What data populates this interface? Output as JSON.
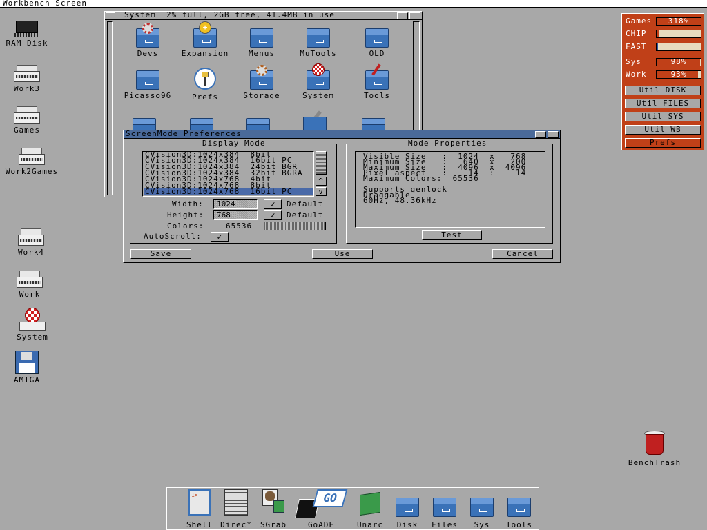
{
  "screen_title": "Workbench Screen",
  "desktop_icons": [
    {
      "label": "RAM Disk",
      "icon": "ram-chip-icon"
    },
    {
      "label": "Work3",
      "icon": "hard-drive-icon"
    },
    {
      "label": "Games",
      "icon": "hard-drive-icon"
    },
    {
      "label": "Work2Games",
      "icon": "hard-drive-icon"
    },
    {
      "label": "Work4",
      "icon": "hard-drive-icon"
    },
    {
      "label": "Work",
      "icon": "hard-drive-icon"
    },
    {
      "label": "System",
      "icon": "boing-ball-drive-icon"
    },
    {
      "label": "AMIGA",
      "icon": "floppy-disk-icon"
    },
    {
      "label": "BenchTrash",
      "icon": "trashcan-icon"
    }
  ],
  "system_window": {
    "title": "System  2% full, 2GB free, 41.4MB in use",
    "icons": [
      {
        "label": "Devs",
        "icon": "gear-drawer-icon"
      },
      {
        "label": "Expansion",
        "icon": "plus-drawer-icon"
      },
      {
        "label": "Menus",
        "icon": "drawer-icon"
      },
      {
        "label": "MuTools",
        "icon": "drawer-icon"
      },
      {
        "label": "OLD",
        "icon": "drawer-icon"
      },
      {
        "label": "Picasso96",
        "icon": "drawer-icon"
      },
      {
        "label": "Prefs",
        "icon": "prefs-switch-icon"
      },
      {
        "label": "Storage",
        "icon": "gear-drawer-icon"
      },
      {
        "label": "System",
        "icon": "boing-drawer-icon"
      },
      {
        "label": "Tools",
        "icon": "screwdriver-drawer-icon"
      }
    ]
  },
  "screenmode": {
    "title": "ScreenMode Preferences",
    "display_mode_heading": "Display Mode",
    "mode_properties_heading": "Mode Properties",
    "modes": [
      "CVision3D:1024x384  8bit",
      "CVision3D:1024x384  16bit PC",
      "CVision3D:1024x384  24bit BGR",
      "CVision3D:1024x384  32bit BGRA",
      "CVision3D:1024x768  4bit",
      "CVision3D:1024x768  8bit",
      "CVision3D:1024x768  16bit PC"
    ],
    "selected_mode_index": 6,
    "width_label": "Width:",
    "width_value": "1024",
    "height_label": "Height:",
    "height_value": "768",
    "colors_label": "Colors:",
    "colors_value": "65536",
    "autoscroll_label": "AutoScroll:",
    "default_label": "Default",
    "check_mark": "✓",
    "properties": [
      "Visible Size   :  1024  x   768",
      "Minimum Size   :   640  x   200",
      "Maximum Size   :  4096  x  4096",
      "Pixel aspect   :    14  :    14",
      "Maximum Colors:  65536",
      "",
      "Supports genlock",
      "Draggable",
      "60Hz, 48.36kHz"
    ],
    "test_label": "Test",
    "save_label": "Save",
    "use_label": "Use",
    "cancel_label": "Cancel",
    "scroll_up": "^",
    "scroll_down": "v"
  },
  "monitor": {
    "meters": [
      {
        "name": "Games",
        "value": "318%",
        "fill": 1.0,
        "color": "#c04018"
      },
      {
        "name": "CHIP",
        "value": "",
        "fill": 0.06,
        "color": "#c04018"
      },
      {
        "name": "FAST",
        "value": "",
        "fill": 0.03,
        "color": "#3050a0"
      },
      {
        "name": "Sys",
        "value": "98%",
        "fill": 0.98,
        "color": "#c04018"
      },
      {
        "name": "Work",
        "value": "93%",
        "fill": 0.93,
        "color": "#c04018"
      }
    ],
    "buttons": [
      "Util DISK",
      "Util FILES",
      "Util SYS",
      "Util WB",
      "Prefs"
    ],
    "panel_color": "#c04018"
  },
  "dock": {
    "items": [
      {
        "label": "Shell",
        "icon": "shell-icon"
      },
      {
        "label": "Direc*",
        "icon": "directory-opus-icon"
      },
      {
        "label": "SGrab",
        "icon": "screen-grab-icon"
      },
      {
        "label": "GoADF",
        "icon": "goadf-icon"
      },
      {
        "label": "Unarc",
        "icon": "unarc-box-icon"
      },
      {
        "label": "Disk",
        "icon": "drawer-icon"
      },
      {
        "label": "Files",
        "icon": "drawer-icon"
      },
      {
        "label": "Sys",
        "icon": "drawer-icon"
      },
      {
        "label": "Tools",
        "icon": "drawer-icon"
      }
    ]
  }
}
